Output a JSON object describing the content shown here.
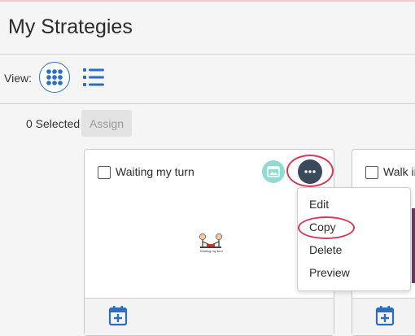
{
  "header": {
    "title": "My Strategies"
  },
  "view": {
    "label": "View:",
    "grid_icon": "grid-icon",
    "list_icon": "list-icon"
  },
  "selection": {
    "selected_text": "0 Selected",
    "assign_label": "Assign"
  },
  "cards": [
    {
      "title": "Waiting my turn",
      "picture_caption": "Waiting my turn",
      "image_icon": "image-icon",
      "more_icon": "more-icon",
      "calendar_icon": "calendar-add-icon"
    },
    {
      "title": "Walk in",
      "calendar_icon": "calendar-add-icon"
    }
  ],
  "menu": {
    "items": [
      "Edit",
      "Copy",
      "Delete",
      "Preview"
    ]
  },
  "colors": {
    "accent": "#2a6fc4",
    "highlight_ring": "#d63a58",
    "teal": "#8fdcd2",
    "dark_button": "#3b4a5a"
  }
}
